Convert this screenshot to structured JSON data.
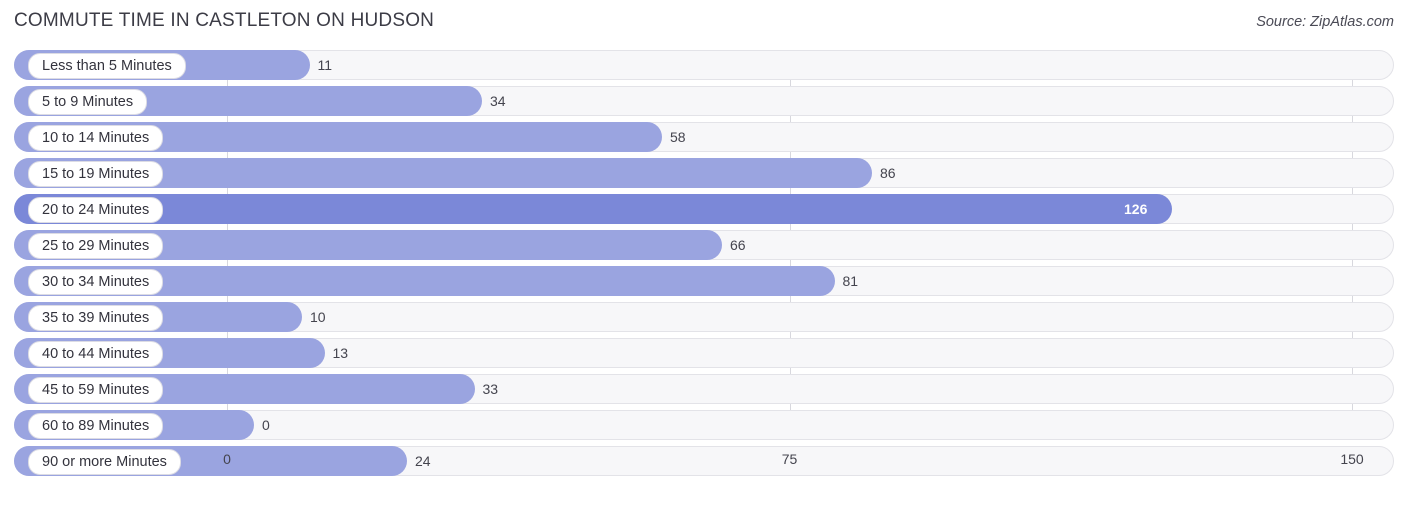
{
  "header": {
    "title": "COMMUTE TIME IN CASTLETON ON HUDSON",
    "source": "Source: ZipAtlas.com"
  },
  "colors": {
    "bar": "#9aa4e0",
    "bar_highlight": "#7b88d8",
    "track": "#f7f7f9",
    "grid": "#d8d8de",
    "text": "#3c3c46"
  },
  "chart_data": {
    "type": "bar",
    "orientation": "horizontal",
    "title": "COMMUTE TIME IN CASTLETON ON HUDSON",
    "xlabel": "",
    "ylabel": "",
    "xlim": [
      0,
      150
    ],
    "xticks": [
      "0",
      "75",
      "150"
    ],
    "xtick_values": [
      0,
      75,
      150
    ],
    "grid": true,
    "legend": "none",
    "categories": [
      "Less than 5 Minutes",
      "5 to 9 Minutes",
      "10 to 14 Minutes",
      "15 to 19 Minutes",
      "20 to 24 Minutes",
      "25 to 29 Minutes",
      "30 to 34 Minutes",
      "35 to 39 Minutes",
      "40 to 44 Minutes",
      "45 to 59 Minutes",
      "60 to 89 Minutes",
      "90 or more Minutes"
    ],
    "values": [
      11,
      34,
      58,
      86,
      126,
      66,
      81,
      10,
      13,
      33,
      0,
      24
    ],
    "value_labels": [
      "11",
      "34",
      "58",
      "86",
      "126",
      "66",
      "81",
      "10",
      "13",
      "33",
      "0",
      "24"
    ],
    "label_inside": [
      false,
      false,
      false,
      false,
      true,
      false,
      false,
      false,
      false,
      false,
      false,
      false
    ]
  }
}
